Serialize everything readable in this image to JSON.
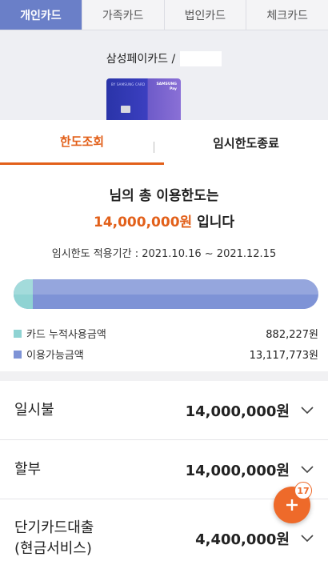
{
  "top_tabs": [
    {
      "label": "개인카드",
      "active": true
    },
    {
      "label": "가족카드",
      "active": false
    },
    {
      "label": "법인카드",
      "active": false
    },
    {
      "label": "체크카드",
      "active": false
    }
  ],
  "card": {
    "name": "삼성페이카드 /",
    "brand_left": "BY SAMSUNG CARD",
    "brand_right": "SAMSUNG",
    "brand_right_sub": "Pay"
  },
  "sub_tabs": [
    {
      "label": "한도조회",
      "active": true
    },
    {
      "label": "임시한도종료",
      "active": false
    }
  ],
  "summary": {
    "line1": "님의 총 이용한도는",
    "amount": "14,000,000원",
    "suffix": " 입니다",
    "period": "임시한도 적용기간 : 2021.10.16 ~ 2021.12.15"
  },
  "usage_bar": {
    "used_fraction": 0.063,
    "used_color": "#8fd3d3",
    "available_color": "#7e93d6"
  },
  "legend": [
    {
      "label": "카드 누적사용금액",
      "value": "882,227원",
      "color": "#8fd3d3"
    },
    {
      "label": "이용가능금액",
      "value": "13,117,773원",
      "color": "#7e93d6"
    }
  ],
  "limits": [
    {
      "label": "일시불",
      "amount": "14,000,000원"
    },
    {
      "label": "할부",
      "amount": "14,000,000원"
    },
    {
      "label": "단기카드대출\n(현금서비스)",
      "label_line1": "단기카드대출",
      "label_line2": "(현금서비스)",
      "amount": "4,400,000원"
    }
  ],
  "fab": {
    "badge": "17",
    "icon": "plus-icon"
  },
  "colors": {
    "accent": "#e2601a",
    "tab_active": "#6a7fc8"
  }
}
